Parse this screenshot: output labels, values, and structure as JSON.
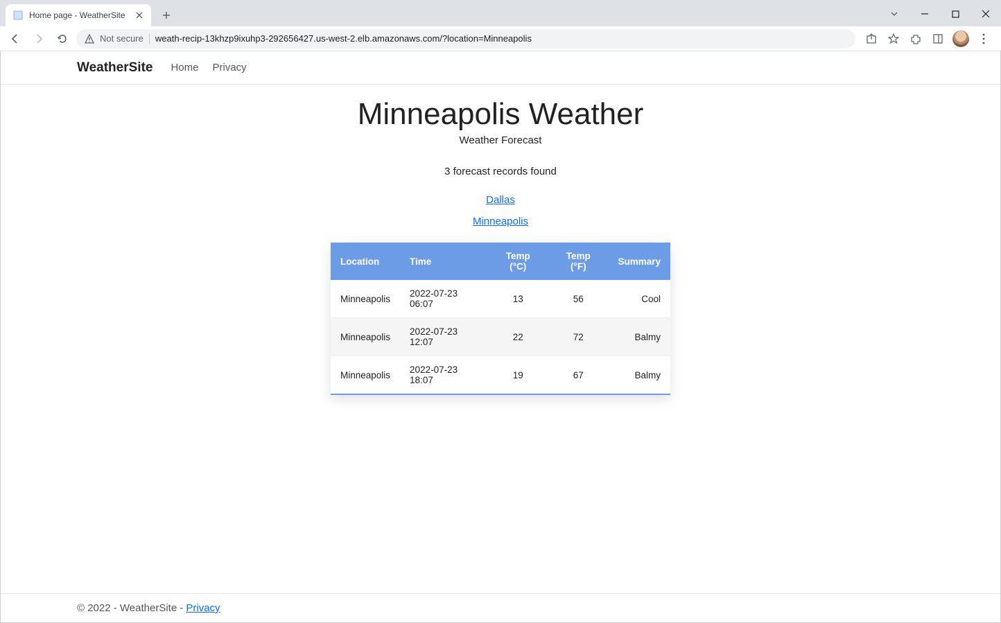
{
  "browser": {
    "tab_title": "Home page - WeatherSite",
    "url": "weath-recip-13khzp9ixuhp3-292656427.us-west-2.elb.amazonaws.com/?location=Minneapolis",
    "not_secure_label": "Not secure"
  },
  "nav": {
    "brand": "WeatherSite",
    "links": [
      "Home",
      "Privacy"
    ]
  },
  "main": {
    "title": "Minneapolis Weather",
    "subtitle": "Weather Forecast",
    "count_text": "3 forecast records found",
    "location_links": [
      "Dallas",
      "Minneapolis"
    ]
  },
  "table": {
    "headers": [
      "Location",
      "Time",
      "Temp (°C)",
      "Temp (°F)",
      "Summary"
    ],
    "rows": [
      {
        "location": "Minneapolis",
        "time": "2022-07-23 06:07",
        "tc": "13",
        "tf": "56",
        "summary": "Cool"
      },
      {
        "location": "Minneapolis",
        "time": "2022-07-23 12:07",
        "tc": "22",
        "tf": "72",
        "summary": "Balmy"
      },
      {
        "location": "Minneapolis",
        "time": "2022-07-23 18:07",
        "tc": "19",
        "tf": "67",
        "summary": "Balmy"
      }
    ]
  },
  "footer": {
    "text": "© 2022 - WeatherSite - ",
    "privacy": "Privacy"
  }
}
